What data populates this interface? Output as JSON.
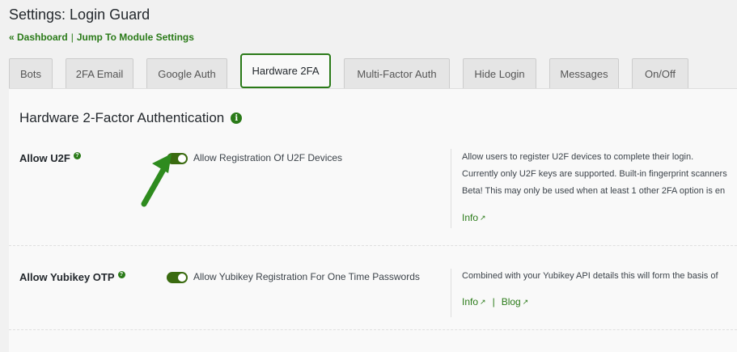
{
  "header": {
    "title": "Settings: Login Guard",
    "dashboard_link": "« Dashboard",
    "separator": "|",
    "jump_link": "Jump To Module Settings"
  },
  "tabs": [
    {
      "label": "Bots"
    },
    {
      "label": "2FA Email"
    },
    {
      "label": "Google Auth"
    },
    {
      "label": "Hardware 2FA"
    },
    {
      "label": "Multi-Factor Auth"
    },
    {
      "label": "Hide Login"
    },
    {
      "label": "Messages"
    },
    {
      "label": "On/Off"
    }
  ],
  "section": {
    "title": "Hardware 2-Factor Authentication",
    "info_glyph": "i"
  },
  "rows": [
    {
      "label": "Allow U2F",
      "help_glyph": "?",
      "toggle_on": true,
      "toggle_label": "Allow Registration Of U2F Devices",
      "description": [
        "Allow users to register U2F devices to complete their login.",
        "Currently only U2F keys are supported. Built-in fingerprint scanners",
        "Beta! This may only be used when at least 1 other 2FA option is en"
      ],
      "links": [
        "Info"
      ]
    },
    {
      "label": "Allow Yubikey OTP",
      "help_glyph": "?",
      "toggle_on": true,
      "toggle_label": "Allow Yubikey Registration For One Time Passwords",
      "description": [
        "Combined with your Yubikey API details this will form the basis of"
      ],
      "links": [
        "Info",
        "Blog"
      ],
      "link_separator": "|"
    }
  ],
  "colors": {
    "accent": "#2a7a18",
    "toggle": "#3a6b10",
    "arrow": "#2e8b1e"
  }
}
